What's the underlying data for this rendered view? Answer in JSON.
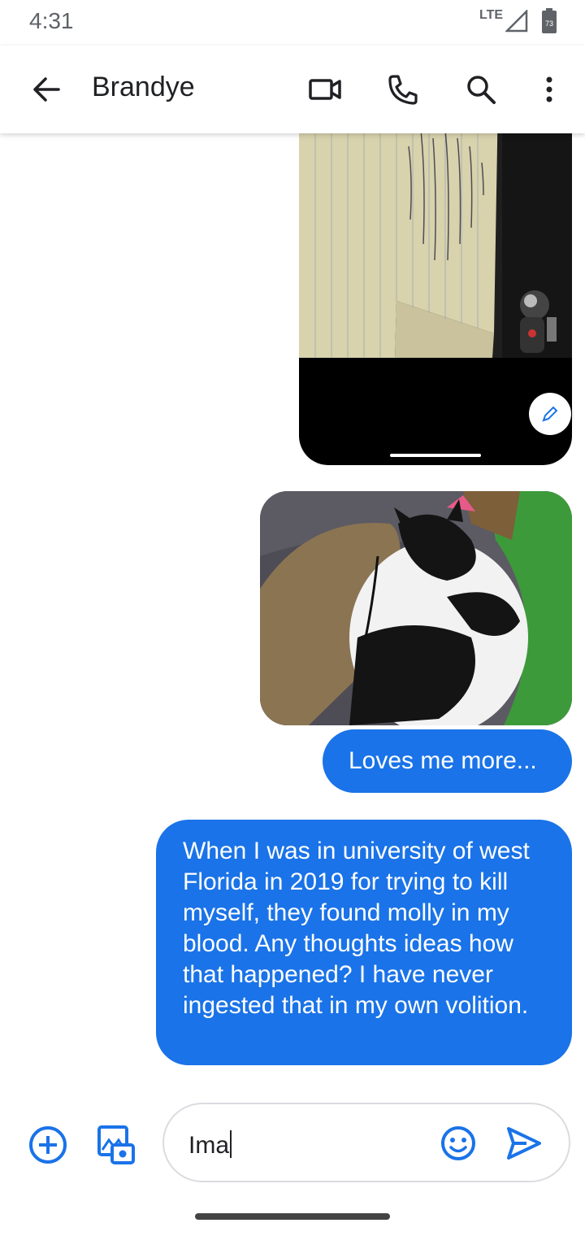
{
  "status_bar": {
    "time": "4:31",
    "network": "LTE",
    "battery_level": "73"
  },
  "app_bar": {
    "contact_name": "Brandye",
    "icons": [
      "back-arrow-icon",
      "video-call-icon",
      "phone-icon",
      "search-icon",
      "more-vert-icon"
    ]
  },
  "messages": [
    {
      "type": "image",
      "description_icon": "photo-letter"
    },
    {
      "type": "image",
      "description_icon": "photo-cat"
    },
    {
      "type": "text",
      "text": "Loves me more..."
    },
    {
      "type": "text",
      "text": "When I was in university of west Florida in 2019 for trying to kill myself, they found molly in my blood. Any thoughts ideas how that happened? I have never ingested that in my own volition."
    }
  ],
  "composer": {
    "input_value": "Ima",
    "icons": [
      "add-circle-icon",
      "gallery-camera-icon",
      "emoji-icon",
      "send-icon"
    ]
  },
  "colors": {
    "accent": "#1a73e8",
    "bubble_text": "#ffffff"
  }
}
